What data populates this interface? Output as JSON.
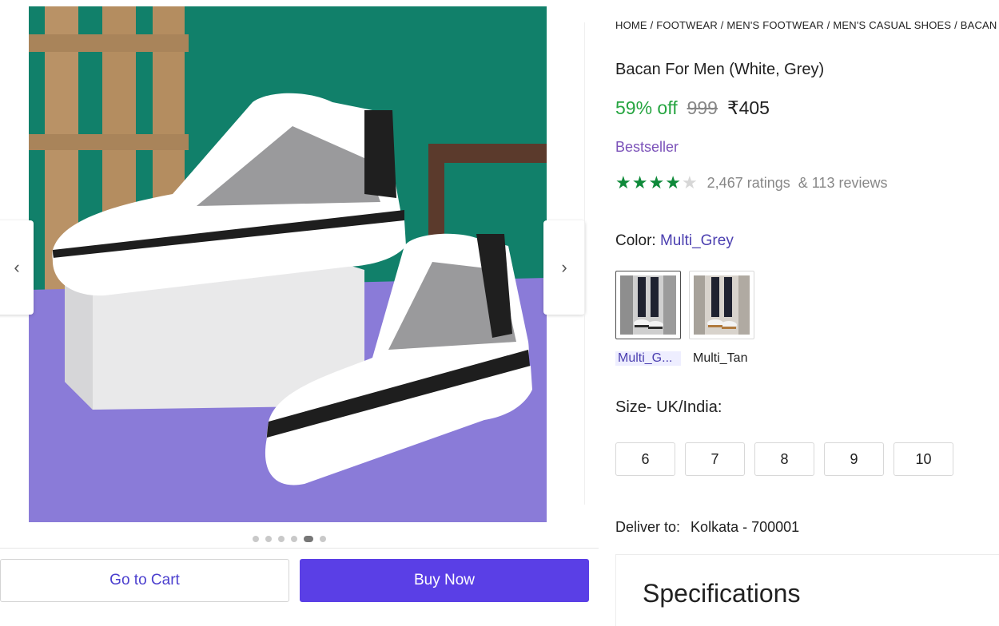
{
  "gallery": {
    "prev_label": "‹",
    "next_label": "›",
    "dots_total": 6,
    "active_dot": 4,
    "main_image_icon": "sneaker-photo"
  },
  "actions": {
    "cart_label": "Go to Cart",
    "buy_label": "Buy Now"
  },
  "product": {
    "breadcrumb": "HOME / FOOTWEAR / MEN'S FOOTWEAR / MEN'S CASUAL SHOES / BACAN",
    "title": "Bacan For Men (White, Grey)",
    "discount": "59% off",
    "mrp": "999",
    "price": "₹405",
    "badge": "Bestseller",
    "rating_value": 4,
    "rating_max": 5,
    "ratings_text": "2,467 ratings",
    "reviews_text": "& 113 reviews"
  },
  "color": {
    "label": "Color:",
    "selected": "Multi_Grey",
    "options": [
      {
        "label": "Multi_G...",
        "selected": true
      },
      {
        "label": "Multi_Tan",
        "selected": false
      }
    ]
  },
  "size": {
    "label": "Size- UK/India:",
    "options": [
      "6",
      "7",
      "8",
      "9",
      "10"
    ]
  },
  "delivery": {
    "label": "Deliver to:",
    "location": "Kolkata - 700001"
  },
  "specifications": {
    "title": "Specifications"
  },
  "colors": {
    "accent": "#5a3fe6",
    "discount_green": "#26a541",
    "bestseller_purple": "#7b52b9",
    "star_green": "#0f8a3a"
  }
}
